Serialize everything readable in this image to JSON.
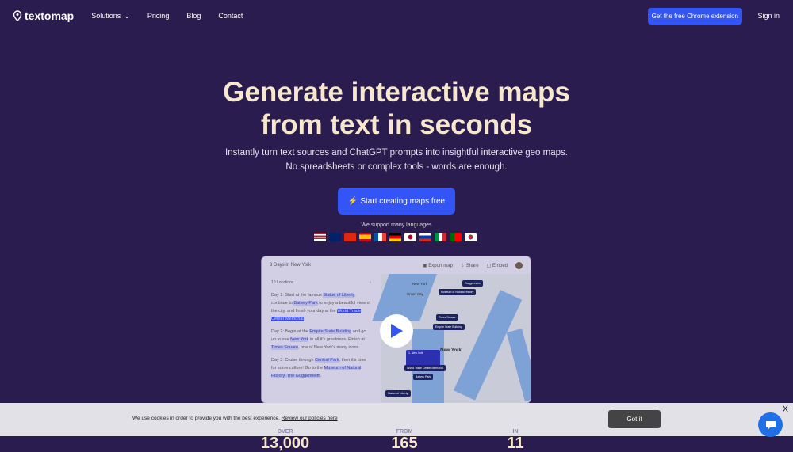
{
  "nav": {
    "logo": "textomap",
    "items": [
      "Solutions",
      "Pricing",
      "Blog",
      "Contact"
    ],
    "cta": "Get the free Chrome extension",
    "signin": "Sign in"
  },
  "hero": {
    "title_line1": "Generate interactive maps",
    "title_line2": "from text in seconds",
    "sub_line1": "Instantly turn text sources and ChatGPT prompts into insightful interactive geo maps.",
    "sub_line2": "No spreadsheets or complex tools - words are enough.",
    "start": "Start creating maps free",
    "languages": "We support many languages",
    "flags": [
      "US",
      "GB",
      "CN",
      "ES",
      "FR",
      "DE",
      "JP",
      "RU",
      "IT",
      "PT",
      "KR"
    ]
  },
  "video": {
    "title": "3 Days in New York",
    "export": "Export map",
    "share": "Share",
    "embed": "Embed",
    "locations": "10 Locations",
    "day1": [
      "Day 1: Start at the famous ",
      "Statue of Liberty",
      ", continue to ",
      "Battery Park",
      " to enjoy a beautiful view of the city, and finish your day at the ",
      "World Trade Center Memorial"
    ],
    "day2": [
      "Day 2: Begin at the ",
      "Empire State Building",
      " and go up to see ",
      "New York",
      " in all it's greatness. Finish at ",
      "Times Square",
      ", one of New York's many icons."
    ],
    "day3": [
      "Day 3: Cruise through ",
      "Central Park",
      ", then it's time for some culture! Go to the ",
      "Museum of Natural History, The Guggenheim",
      "."
    ],
    "tags": [
      "Guggenheim",
      "Museum of Natural History",
      "Times Square",
      "Empire State Building",
      "1. New York",
      "World Trade Center Memorial",
      "Battery Park",
      "Statue of Liberty"
    ],
    "map_labels": [
      "New York",
      "Union City",
      "New York"
    ]
  },
  "cookie": {
    "message": "We use cookies in order to provide you with the best experience.",
    "link": "Review our policies here",
    "button": "Got it",
    "close": "X"
  },
  "stats": [
    {
      "label": "OVER",
      "value": "13,000"
    },
    {
      "label": "FROM",
      "value": "165"
    },
    {
      "label": "IN",
      "value": "11"
    }
  ]
}
